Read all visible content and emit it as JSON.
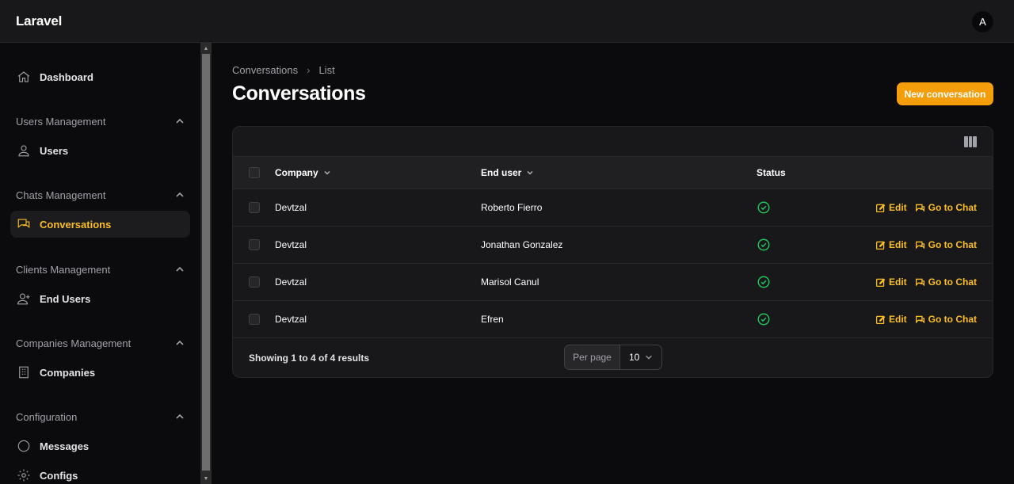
{
  "app": {
    "brand": "Laravel",
    "avatar_initial": "A"
  },
  "sidebar": {
    "dashboard": "Dashboard",
    "groups": [
      {
        "label": "Users Management",
        "items": [
          "Users"
        ]
      },
      {
        "label": "Chats Management",
        "items": [
          "Conversations"
        ]
      },
      {
        "label": "Clients Management",
        "items": [
          "End Users"
        ]
      },
      {
        "label": "Companies Management",
        "items": [
          "Companies"
        ]
      },
      {
        "label": "Configuration",
        "items": [
          "Messages",
          "Configs"
        ]
      }
    ],
    "active": "Conversations"
  },
  "breadcrumb": {
    "first": "Conversations",
    "second": "List"
  },
  "page": {
    "title": "Conversations",
    "new_button": "New conversation"
  },
  "table": {
    "headers": {
      "company": "Company",
      "end_user": "End user",
      "status": "Status"
    },
    "rows": [
      {
        "company": "Devtzal",
        "end_user": "Roberto Fierro",
        "status_icon": "check-circle-icon",
        "edit": "Edit",
        "go": "Go to Chat"
      },
      {
        "company": "Devtzal",
        "end_user": "Jonathan Gonzalez",
        "status_icon": "check-circle-icon",
        "edit": "Edit",
        "go": "Go to Chat"
      },
      {
        "company": "Devtzal",
        "end_user": "Marisol Canul",
        "status_icon": "check-circle-icon",
        "edit": "Edit",
        "go": "Go to Chat"
      },
      {
        "company": "Devtzal",
        "end_user": "Efren",
        "status_icon": "check-circle-icon",
        "edit": "Edit",
        "go": "Go to Chat"
      }
    ],
    "footer": {
      "showing": "Showing 1 to 4 of 4 results",
      "per_page_label": "Per page",
      "per_page_value": "10"
    }
  },
  "colors": {
    "accent": "#f59e0b",
    "status_ok": "#22c55e",
    "background": "#0b0b0d",
    "surface": "#18181b"
  }
}
